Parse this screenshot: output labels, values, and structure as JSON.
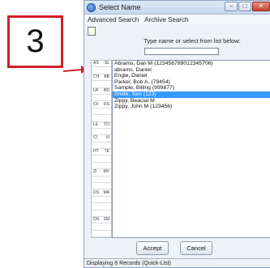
{
  "callout": {
    "number": "3",
    "color": "#d21f26"
  },
  "window": {
    "title": "Select Name",
    "controls": {
      "minimize": "–",
      "maximize": "□",
      "close": "✕"
    }
  },
  "menu": {
    "items": [
      "Advanced Search",
      "Archive Search"
    ]
  },
  "toolbar": {
    "icon": "document-icon"
  },
  "search": {
    "prompt": "Type name or select from list below:",
    "value": ""
  },
  "alpha_index": [
    [
      "AS",
      "SL"
    ],
    [
      "",
      ""
    ],
    [
      "CH",
      "BB"
    ],
    [
      "",
      ""
    ],
    [
      "UF",
      "BD"
    ],
    [
      "",
      ""
    ],
    [
      "CF",
      "RS"
    ],
    [
      "",
      ""
    ],
    [
      "",
      ""
    ],
    [
      "LE",
      "TO"
    ],
    [
      "",
      ""
    ],
    [
      "CI",
      "VI"
    ],
    [
      "",
      ""
    ],
    [
      "HT",
      "TE"
    ],
    [
      "",
      ""
    ],
    [
      "",
      ""
    ],
    [
      "ZI",
      "MV"
    ],
    [
      "",
      ""
    ],
    [
      "",
      ""
    ],
    [
      "DS",
      "MA"
    ],
    [
      "",
      ""
    ],
    [
      "",
      ""
    ],
    [
      "",
      ""
    ],
    [
      "OS",
      "SM"
    ],
    [
      "",
      ""
    ],
    [
      "",
      ""
    ]
  ],
  "list": {
    "items": [
      {
        "text": "Abrams, Dan M (123456789012345706)",
        "selected": false
      },
      {
        "text": "abrams, Daniel",
        "selected": false
      },
      {
        "text": "Engle, Daniel",
        "selected": false
      },
      {
        "text": "Parker, Bob A. (79454)",
        "selected": false
      },
      {
        "text": "Sample, Billing (999877)",
        "selected": false
      },
      {
        "text": "Smith, Tom (123)",
        "selected": true
      },
      {
        "text": "Zippy, Beacial M",
        "selected": false
      },
      {
        "text": "Zippy, John M (123456)",
        "selected": false
      }
    ]
  },
  "buttons": {
    "accept": "Accept",
    "cancel": "Cancel"
  },
  "status": "Displaying 8 Records (Quick-List)"
}
